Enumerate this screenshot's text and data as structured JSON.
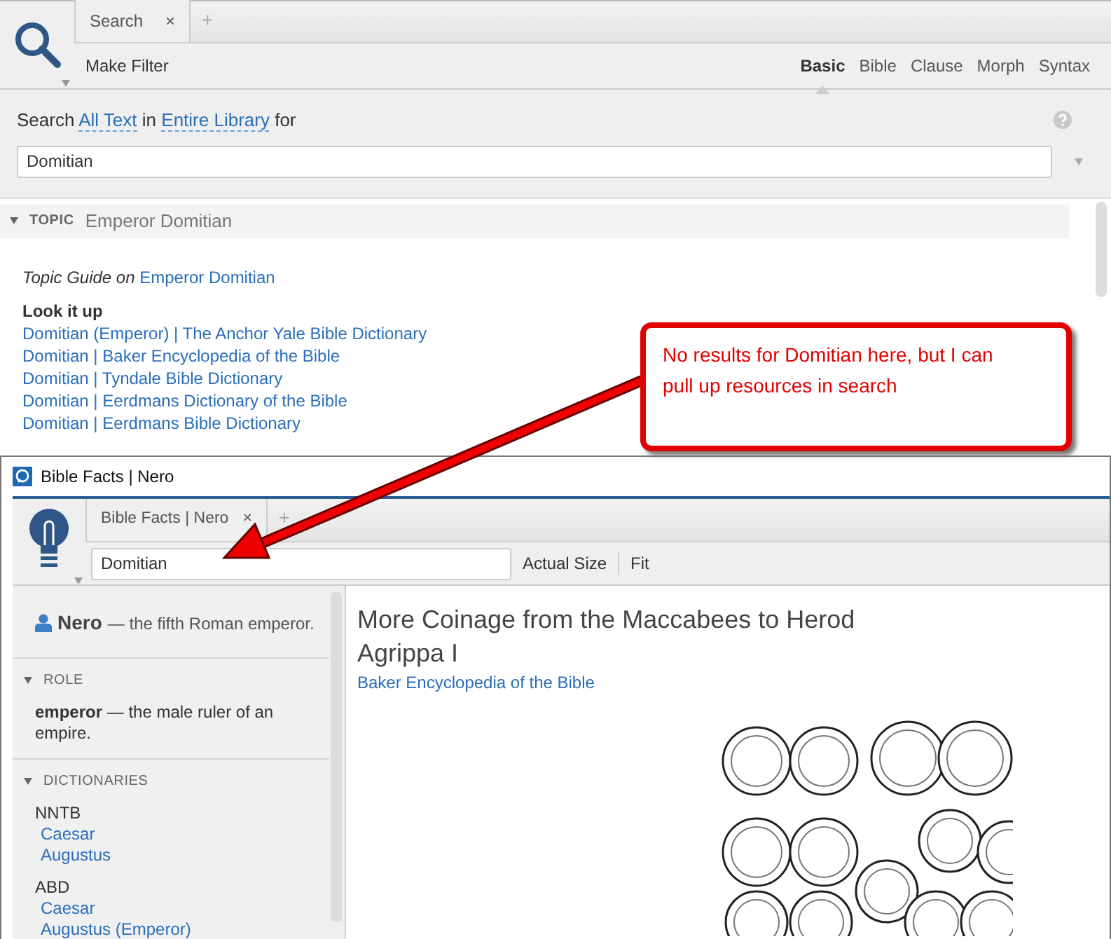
{
  "search_window": {
    "tab": {
      "label": "Search",
      "close": "×",
      "selected": true
    },
    "new_tab": "+",
    "make_filter": "Make Filter",
    "modes": [
      {
        "label": "Basic",
        "selected": true
      },
      {
        "label": "Bible",
        "selected": false
      },
      {
        "label": "Clause",
        "selected": false
      },
      {
        "label": "Morph",
        "selected": false
      },
      {
        "label": "Syntax",
        "selected": false
      }
    ],
    "query": {
      "prefix": "Search",
      "scope": "All Text",
      "middle": "in",
      "library": "Entire Library",
      "suffix": "for",
      "value": "Domitian"
    },
    "topic": {
      "label": "TOPIC",
      "title": "Emperor Domitian",
      "expanded": true,
      "guide_prefix": "Topic Guide on",
      "guide_link": "Emperor Domitian",
      "look_up_heading": "Look it up",
      "links": [
        "Domitian (Emperor) | The Anchor Yale Bible Dictionary",
        "Domitian | Baker Encyclopedia of the Bible",
        "Domitian | Tyndale Bible Dictionary",
        "Domitian | Eerdmans Dictionary of the Bible",
        "Domitian | Eerdmans Bible Dictionary"
      ]
    }
  },
  "annotation": {
    "text": "No results for Domitian here, but I can pull up resources in search"
  },
  "facts_window": {
    "title": "Bible Facts | Nero",
    "tab": {
      "label": "Bible Facts | Nero",
      "close": "×",
      "selected": true
    },
    "new_tab": "+",
    "field_value": "Domitian",
    "actions": [
      "Actual Size",
      "Fit"
    ],
    "entity": {
      "name": "Nero",
      "description": "— the fifth Roman emperor."
    },
    "sections": [
      {
        "heading": "ROLE",
        "kind": "definition",
        "expanded": true,
        "term": "emperor",
        "definition": "— the male ruler of an empire."
      },
      {
        "heading": "DICTIONARIES",
        "kind": "dictionaries",
        "expanded": true,
        "groups": [
          {
            "name": "NNTB",
            "links": [
              "Caesar",
              "Augustus"
            ]
          },
          {
            "name": "ABD",
            "links": [
              "Caesar",
              "Augustus (Emperor)"
            ]
          }
        ]
      }
    ],
    "article": {
      "title": "More Coinage from the Maccabees to Herod Agrippa I",
      "source": "Baker Encyclopedia of the Bible"
    }
  }
}
